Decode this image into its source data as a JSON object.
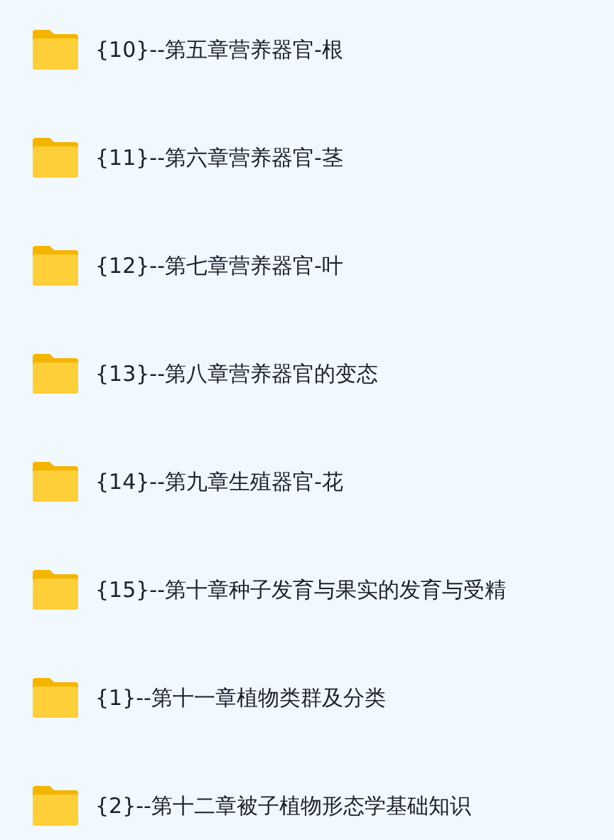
{
  "folders": [
    {
      "name": "{10}--第五章营养器官-根"
    },
    {
      "name": "{11}--第六章营养器官-茎"
    },
    {
      "name": "{12}--第七章营养器官-叶"
    },
    {
      "name": "{13}--第八章营养器官的变态"
    },
    {
      "name": "{14}--第九章生殖器官-花"
    },
    {
      "name": "{15}--第十章种子发育与果实的发育与受精"
    },
    {
      "name": "{1}--第十一章植物类群及分类"
    },
    {
      "name": "{2}--第十二章被子植物形态学基础知识"
    }
  ]
}
